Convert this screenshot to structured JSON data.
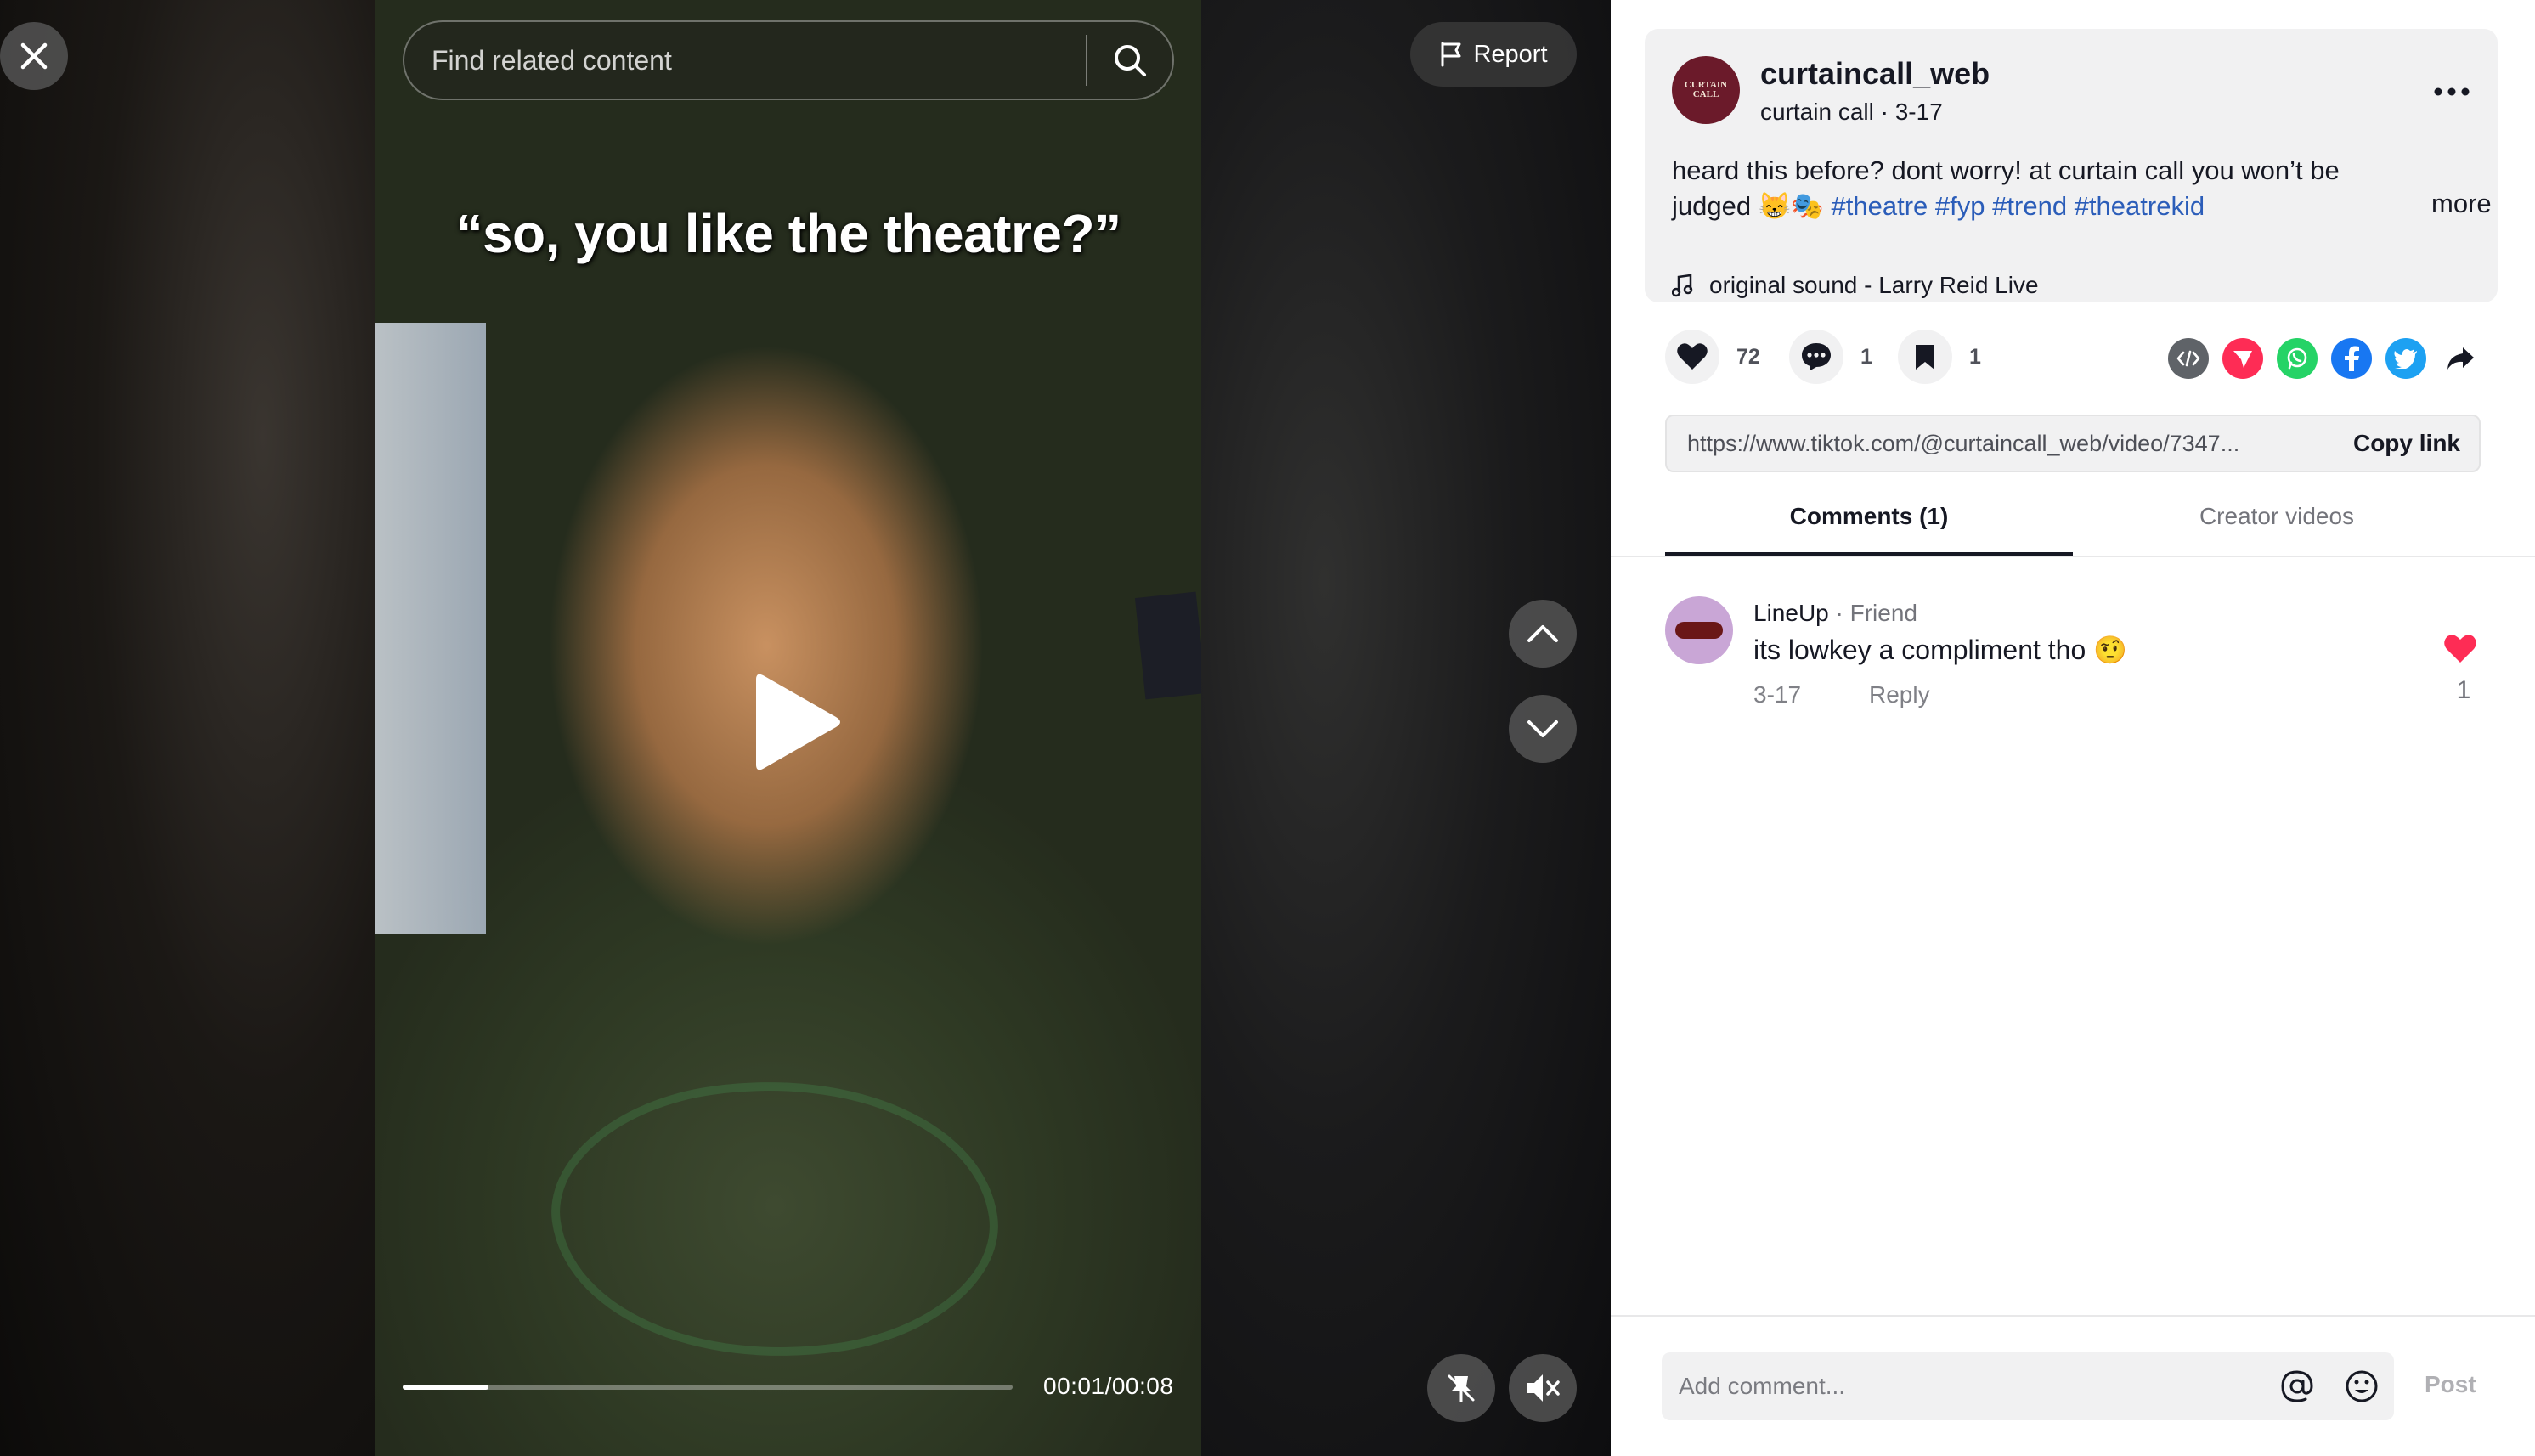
{
  "video": {
    "overlay_caption": "“so, you like the theatre?”",
    "search_placeholder": "Find related content",
    "report_label": "Report",
    "time": "00:01/00:08",
    "progress": 0.14
  },
  "post": {
    "username": "curtaincall_web",
    "display_name": "curtain call",
    "date": "3-17",
    "avatar_text": "CURTAIN CALL",
    "description": "heard this before? dont worry! at curtain call you won’t be judged 😸🎭",
    "hashtags": [
      "#theatre",
      "#fyp",
      "#trend",
      "#theatrekid"
    ],
    "more_label": "more",
    "sound": "original sound - Larry Reid Live"
  },
  "actions": {
    "likes": "72",
    "comments": "1",
    "saves": "1"
  },
  "share": {
    "link": "https://www.tiktok.com/@curtaincall_web/video/7347...",
    "copy_label": "Copy link"
  },
  "tabs": [
    {
      "label": "Comments (1)",
      "active": true
    },
    {
      "label": "Creator videos",
      "active": false
    }
  ],
  "comments": [
    {
      "author": "LineUp",
      "tag": " · Friend",
      "text": "its lowkey a compliment tho 🤨",
      "date": "3-17",
      "reply_label": "Reply",
      "likes": "1"
    }
  ],
  "composer": {
    "placeholder": "Add comment...",
    "post_label": "Post"
  },
  "colors": {
    "accent_like": "#fe2c55",
    "hashtag": "#2b5db9",
    "embed": "#5f6368",
    "tiktok_friends": "#fe2c55",
    "whatsapp": "#25d366",
    "facebook": "#1877f2",
    "twitter": "#1da1f2"
  }
}
